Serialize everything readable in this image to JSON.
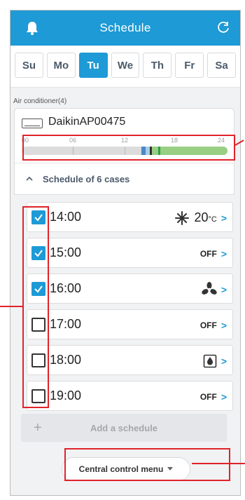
{
  "header": {
    "title": "Schedule",
    "bell_icon": "bell-icon",
    "refresh_icon": "refresh-icon",
    "color": "#1e9ad6"
  },
  "days": [
    {
      "label": "Su",
      "active": false
    },
    {
      "label": "Mo",
      "active": false
    },
    {
      "label": "Tu",
      "active": true
    },
    {
      "label": "We",
      "active": false
    },
    {
      "label": "Th",
      "active": false
    },
    {
      "label": "Fr",
      "active": false
    },
    {
      "label": "Sa",
      "active": false
    }
  ],
  "section_label": "Air conditioner(4)",
  "device": {
    "name": "DaikinAP00475",
    "icon": "air-conditioner-icon",
    "timeline_labels": [
      "00",
      "06",
      "12",
      "18",
      "24"
    ]
  },
  "schedule_header": "Schedule of 6 cases",
  "schedules": [
    {
      "time": "14:00",
      "checked": true,
      "mode": "cool",
      "mode_icon": "snowflake-icon",
      "temp": "20",
      "unit": "°C",
      "status": ""
    },
    {
      "time": "15:00",
      "checked": true,
      "mode": "off",
      "mode_icon": "",
      "temp": "",
      "unit": "",
      "status": "OFF"
    },
    {
      "time": "16:00",
      "checked": true,
      "mode": "fan",
      "mode_icon": "fan-icon",
      "temp": "",
      "unit": "",
      "status": ""
    },
    {
      "time": "17:00",
      "checked": false,
      "mode": "off",
      "mode_icon": "",
      "temp": "",
      "unit": "",
      "status": "OFF"
    },
    {
      "time": "18:00",
      "checked": false,
      "mode": "dry",
      "mode_icon": "dry-mode-icon",
      "temp": "",
      "unit": "",
      "status": ""
    },
    {
      "time": "19:00",
      "checked": false,
      "mode": "off",
      "mode_icon": "",
      "temp": "",
      "unit": "",
      "status": "OFF"
    }
  ],
  "add_button": {
    "label": "Add a schedule",
    "icon": "plus-icon"
  },
  "central_menu": {
    "label": "Central control menu",
    "icon": "caret-down-icon"
  },
  "colors": {
    "accent": "#1e9ad6",
    "highlight": "#e0232a",
    "timeline_on": "#98cf83"
  }
}
